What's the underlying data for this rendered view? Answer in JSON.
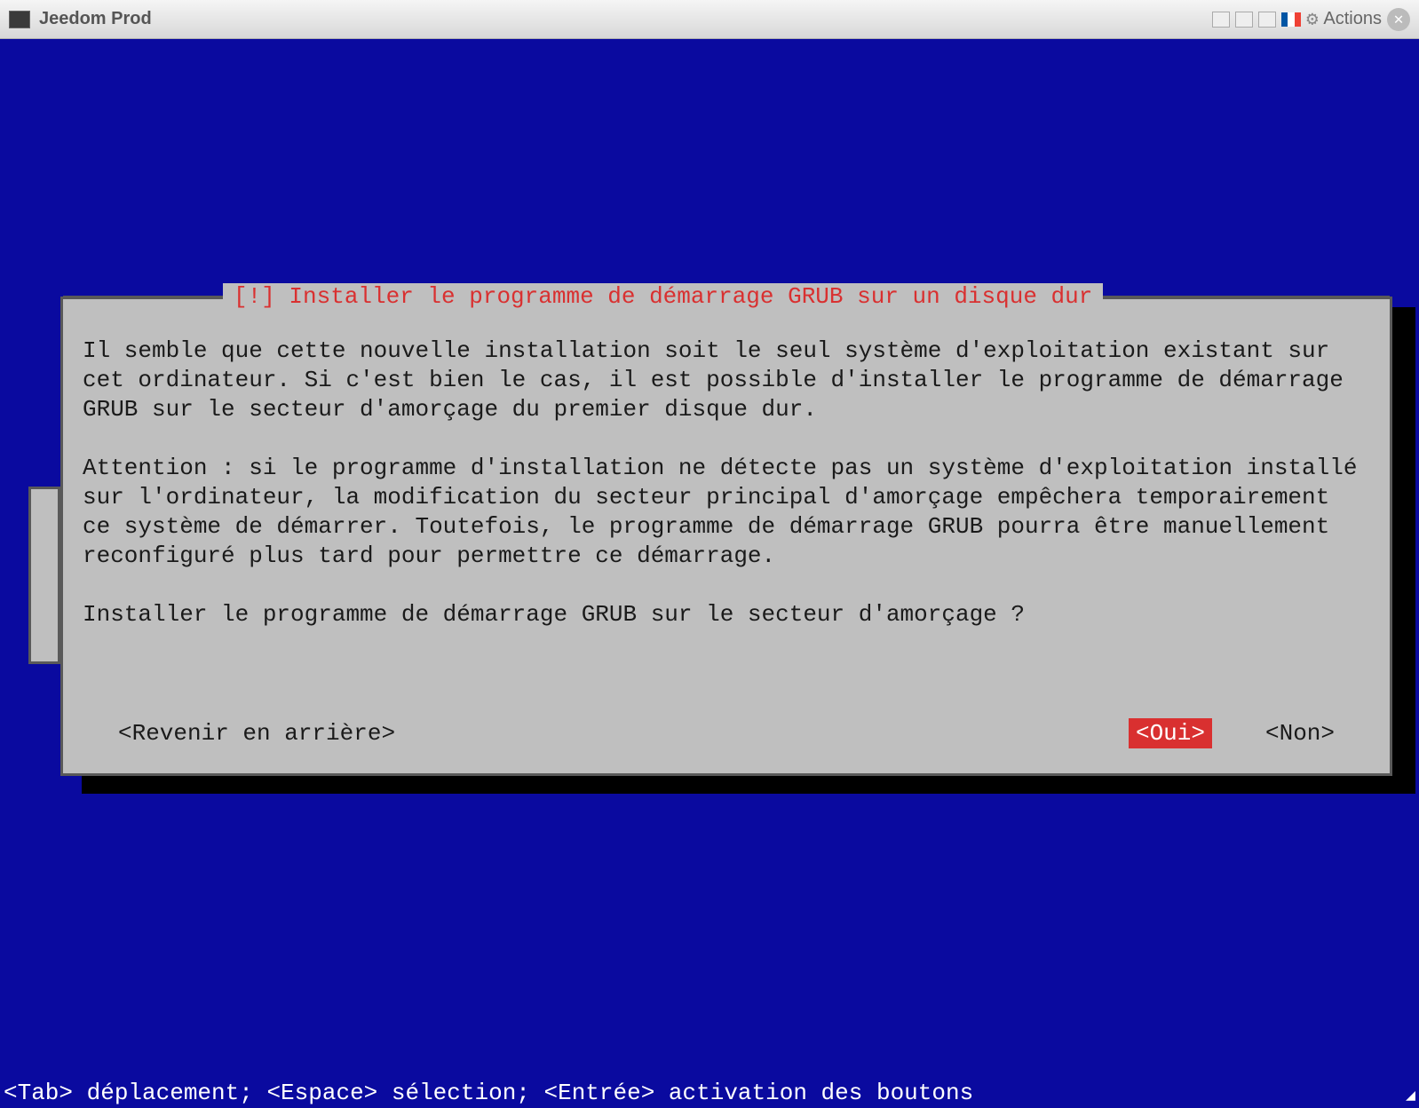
{
  "titlebar": {
    "title": "Jeedom Prod",
    "actions_label": "Actions"
  },
  "dialog": {
    "title": "[!] Installer le programme de démarrage GRUB sur un disque dur",
    "paragraph1": "Il semble que cette nouvelle installation soit le seul système d'exploitation existant sur cet ordinateur. Si c'est bien le cas, il est possible d'installer le programme de démarrage GRUB sur le secteur d'amorçage du premier disque dur.",
    "paragraph2": "Attention : si le programme d'installation ne détecte pas un système d'exploitation installé sur l'ordinateur, la modification du secteur principal d'amorçage empêchera temporairement ce système de démarrer. Toutefois, le programme de démarrage GRUB pourra être manuellement reconfiguré plus tard pour permettre ce démarrage.",
    "question": "Installer le programme de démarrage GRUB sur le secteur d'amorçage ?",
    "back_button": "<Revenir en arrière>",
    "yes_button": "<Oui>",
    "no_button": "<Non>"
  },
  "footer": {
    "help_text": "<Tab> déplacement; <Espace> sélection; <Entrée> activation des boutons"
  }
}
